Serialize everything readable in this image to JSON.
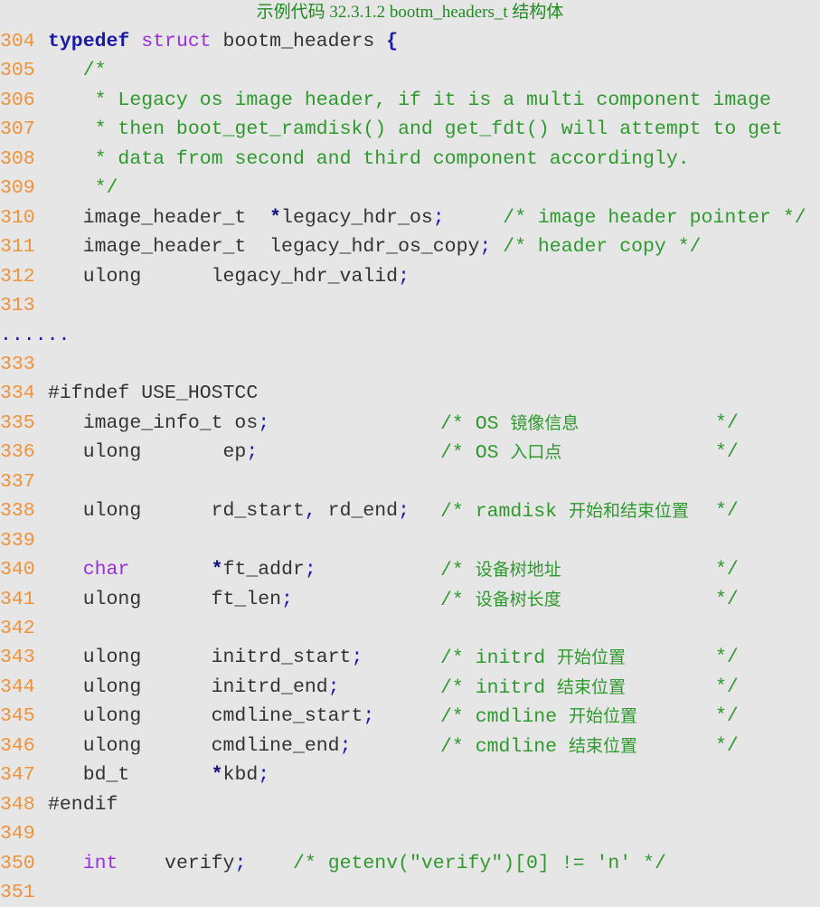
{
  "caption": "示例代码 32.3.1.2 bootm_headers_t 结构体",
  "colors": {
    "background": "#e6e6e6",
    "line_number": "#f0923a",
    "keyword": "#1a1aa6",
    "type_keyword": "#9b30d9",
    "comment": "#2e9a2e",
    "identifier": "#333333",
    "caption": "#1f8a1f"
  },
  "lines": [
    {
      "no": "304",
      "tokens": [
        {
          "t": "kw",
          "v": "typedef"
        },
        {
          "t": "plain",
          "v": " "
        },
        {
          "t": "type",
          "v": "struct"
        },
        {
          "t": "plain",
          "v": " bootm_headers "
        },
        {
          "t": "kw",
          "v": "{"
        }
      ]
    },
    {
      "no": "305",
      "tokens": [
        {
          "t": "plain",
          "v": "   "
        },
        {
          "t": "cmt",
          "v": "/*"
        }
      ]
    },
    {
      "no": "306",
      "tokens": [
        {
          "t": "plain",
          "v": "   "
        },
        {
          "t": "cmt",
          "v": " * Legacy os image header, if it is a multi component image"
        }
      ]
    },
    {
      "no": "307",
      "tokens": [
        {
          "t": "plain",
          "v": "   "
        },
        {
          "t": "cmt",
          "v": " * then boot_get_ramdisk() and get_fdt() will attempt to get"
        }
      ]
    },
    {
      "no": "308",
      "tokens": [
        {
          "t": "plain",
          "v": "   "
        },
        {
          "t": "cmt",
          "v": " * data from second and third component accordingly."
        }
      ]
    },
    {
      "no": "309",
      "tokens": [
        {
          "t": "plain",
          "v": "   "
        },
        {
          "t": "cmt",
          "v": " */"
        }
      ]
    },
    {
      "no": "310",
      "tokens": [
        {
          "t": "plain",
          "v": "   image_header_t  "
        },
        {
          "t": "star",
          "v": "*"
        },
        {
          "t": "plain",
          "v": "legacy_hdr_os"
        },
        {
          "t": "punct",
          "v": ";"
        },
        {
          "t": "plain",
          "v": "     "
        },
        {
          "t": "cmt",
          "v": "/* image header pointer */"
        }
      ]
    },
    {
      "no": "311",
      "tokens": [
        {
          "t": "plain",
          "v": "   image_header_t  legacy_hdr_os_copy"
        },
        {
          "t": "punct",
          "v": ";"
        },
        {
          "t": "plain",
          "v": " "
        },
        {
          "t": "cmt",
          "v": "/* header copy */"
        }
      ]
    },
    {
      "no": "312",
      "tokens": [
        {
          "t": "plain",
          "v": "   ulong      legacy_hdr_valid"
        },
        {
          "t": "punct",
          "v": ";"
        }
      ]
    },
    {
      "no": "313",
      "tokens": []
    },
    {
      "no": "",
      "ellipsis": "......",
      "tokens": []
    },
    {
      "no": "333",
      "tokens": []
    },
    {
      "no": "334",
      "tokens": [
        {
          "t": "plain",
          "v": "#ifndef USE_HOSTCC"
        }
      ]
    },
    {
      "no": "335",
      "tokens": [
        {
          "t": "plain",
          "v": "   image_info_t os"
        },
        {
          "t": "punct",
          "v": ";"
        }
      ],
      "comment": "/* OS 镜像信息",
      "comment_end": "*/"
    },
    {
      "no": "336",
      "tokens": [
        {
          "t": "plain",
          "v": "   ulong       ep"
        },
        {
          "t": "punct",
          "v": ";"
        }
      ],
      "comment": "/* OS 入口点",
      "comment_end": "*/"
    },
    {
      "no": "337",
      "tokens": []
    },
    {
      "no": "338",
      "tokens": [
        {
          "t": "plain",
          "v": "   ulong      rd_start"
        },
        {
          "t": "punct",
          "v": ","
        },
        {
          "t": "plain",
          "v": " rd_end"
        },
        {
          "t": "punct",
          "v": ";"
        }
      ],
      "comment": "/* ramdisk 开始和结束位置",
      "comment_end": "*/"
    },
    {
      "no": "339",
      "tokens": []
    },
    {
      "no": "340",
      "tokens": [
        {
          "t": "plain",
          "v": "   "
        },
        {
          "t": "type",
          "v": "char"
        },
        {
          "t": "plain",
          "v": "       "
        },
        {
          "t": "star",
          "v": "*"
        },
        {
          "t": "plain",
          "v": "ft_addr"
        },
        {
          "t": "punct",
          "v": ";"
        }
      ],
      "comment": "/* 设备树地址",
      "comment_end": "*/"
    },
    {
      "no": "341",
      "tokens": [
        {
          "t": "plain",
          "v": "   ulong      ft_len"
        },
        {
          "t": "punct",
          "v": ";"
        }
      ],
      "comment": "/* 设备树长度",
      "comment_end": "*/"
    },
    {
      "no": "342",
      "tokens": []
    },
    {
      "no": "343",
      "tokens": [
        {
          "t": "plain",
          "v": "   ulong      initrd_start"
        },
        {
          "t": "punct",
          "v": ";"
        }
      ],
      "comment": "/* initrd 开始位置",
      "comment_end": "*/"
    },
    {
      "no": "344",
      "tokens": [
        {
          "t": "plain",
          "v": "   ulong      initrd_end"
        },
        {
          "t": "punct",
          "v": ";"
        }
      ],
      "comment": "/* initrd 结束位置",
      "comment_end": "*/"
    },
    {
      "no": "345",
      "tokens": [
        {
          "t": "plain",
          "v": "   ulong      cmdline_start"
        },
        {
          "t": "punct",
          "v": ";"
        }
      ],
      "comment": "/* cmdline 开始位置",
      "comment_end": "*/"
    },
    {
      "no": "346",
      "tokens": [
        {
          "t": "plain",
          "v": "   ulong      cmdline_end"
        },
        {
          "t": "punct",
          "v": ";"
        }
      ],
      "comment": "/* cmdline 结束位置",
      "comment_end": "*/"
    },
    {
      "no": "347",
      "tokens": [
        {
          "t": "plain",
          "v": "   bd_t       "
        },
        {
          "t": "star",
          "v": "*"
        },
        {
          "t": "plain",
          "v": "kbd"
        },
        {
          "t": "punct",
          "v": ";"
        }
      ]
    },
    {
      "no": "348",
      "tokens": [
        {
          "t": "plain",
          "v": "#endif"
        }
      ]
    },
    {
      "no": "349",
      "tokens": []
    },
    {
      "no": "350",
      "tokens": [
        {
          "t": "plain",
          "v": "   "
        },
        {
          "t": "type",
          "v": "int"
        },
        {
          "t": "plain",
          "v": "    verify"
        },
        {
          "t": "punct",
          "v": ";"
        },
        {
          "t": "plain",
          "v": "    "
        },
        {
          "t": "cmt",
          "v": "/* getenv(\"verify\")[0] != 'n' */"
        }
      ]
    },
    {
      "no": "351",
      "tokens": []
    }
  ]
}
